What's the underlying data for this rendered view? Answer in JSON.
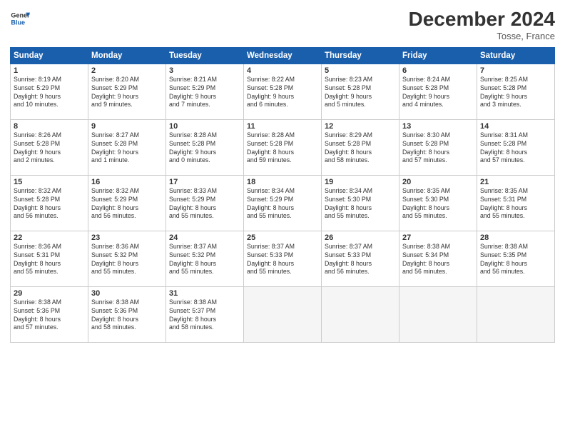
{
  "header": {
    "logo_line1": "General",
    "logo_line2": "Blue",
    "month_title": "December 2024",
    "location": "Tosse, France"
  },
  "weekdays": [
    "Sunday",
    "Monday",
    "Tuesday",
    "Wednesday",
    "Thursday",
    "Friday",
    "Saturday"
  ],
  "weeks": [
    [
      {
        "day": "1",
        "lines": [
          "Sunrise: 8:19 AM",
          "Sunset: 5:29 PM",
          "Daylight: 9 hours",
          "and 10 minutes."
        ]
      },
      {
        "day": "2",
        "lines": [
          "Sunrise: 8:20 AM",
          "Sunset: 5:29 PM",
          "Daylight: 9 hours",
          "and 9 minutes."
        ]
      },
      {
        "day": "3",
        "lines": [
          "Sunrise: 8:21 AM",
          "Sunset: 5:29 PM",
          "Daylight: 9 hours",
          "and 7 minutes."
        ]
      },
      {
        "day": "4",
        "lines": [
          "Sunrise: 8:22 AM",
          "Sunset: 5:28 PM",
          "Daylight: 9 hours",
          "and 6 minutes."
        ]
      },
      {
        "day": "5",
        "lines": [
          "Sunrise: 8:23 AM",
          "Sunset: 5:28 PM",
          "Daylight: 9 hours",
          "and 5 minutes."
        ]
      },
      {
        "day": "6",
        "lines": [
          "Sunrise: 8:24 AM",
          "Sunset: 5:28 PM",
          "Daylight: 9 hours",
          "and 4 minutes."
        ]
      },
      {
        "day": "7",
        "lines": [
          "Sunrise: 8:25 AM",
          "Sunset: 5:28 PM",
          "Daylight: 9 hours",
          "and 3 minutes."
        ]
      }
    ],
    [
      {
        "day": "8",
        "lines": [
          "Sunrise: 8:26 AM",
          "Sunset: 5:28 PM",
          "Daylight: 9 hours",
          "and 2 minutes."
        ]
      },
      {
        "day": "9",
        "lines": [
          "Sunrise: 8:27 AM",
          "Sunset: 5:28 PM",
          "Daylight: 9 hours",
          "and 1 minute."
        ]
      },
      {
        "day": "10",
        "lines": [
          "Sunrise: 8:28 AM",
          "Sunset: 5:28 PM",
          "Daylight: 9 hours",
          "and 0 minutes."
        ]
      },
      {
        "day": "11",
        "lines": [
          "Sunrise: 8:28 AM",
          "Sunset: 5:28 PM",
          "Daylight: 8 hours",
          "and 59 minutes."
        ]
      },
      {
        "day": "12",
        "lines": [
          "Sunrise: 8:29 AM",
          "Sunset: 5:28 PM",
          "Daylight: 8 hours",
          "and 58 minutes."
        ]
      },
      {
        "day": "13",
        "lines": [
          "Sunrise: 8:30 AM",
          "Sunset: 5:28 PM",
          "Daylight: 8 hours",
          "and 57 minutes."
        ]
      },
      {
        "day": "14",
        "lines": [
          "Sunrise: 8:31 AM",
          "Sunset: 5:28 PM",
          "Daylight: 8 hours",
          "and 57 minutes."
        ]
      }
    ],
    [
      {
        "day": "15",
        "lines": [
          "Sunrise: 8:32 AM",
          "Sunset: 5:28 PM",
          "Daylight: 8 hours",
          "and 56 minutes."
        ]
      },
      {
        "day": "16",
        "lines": [
          "Sunrise: 8:32 AM",
          "Sunset: 5:29 PM",
          "Daylight: 8 hours",
          "and 56 minutes."
        ]
      },
      {
        "day": "17",
        "lines": [
          "Sunrise: 8:33 AM",
          "Sunset: 5:29 PM",
          "Daylight: 8 hours",
          "and 55 minutes."
        ]
      },
      {
        "day": "18",
        "lines": [
          "Sunrise: 8:34 AM",
          "Sunset: 5:29 PM",
          "Daylight: 8 hours",
          "and 55 minutes."
        ]
      },
      {
        "day": "19",
        "lines": [
          "Sunrise: 8:34 AM",
          "Sunset: 5:30 PM",
          "Daylight: 8 hours",
          "and 55 minutes."
        ]
      },
      {
        "day": "20",
        "lines": [
          "Sunrise: 8:35 AM",
          "Sunset: 5:30 PM",
          "Daylight: 8 hours",
          "and 55 minutes."
        ]
      },
      {
        "day": "21",
        "lines": [
          "Sunrise: 8:35 AM",
          "Sunset: 5:31 PM",
          "Daylight: 8 hours",
          "and 55 minutes."
        ]
      }
    ],
    [
      {
        "day": "22",
        "lines": [
          "Sunrise: 8:36 AM",
          "Sunset: 5:31 PM",
          "Daylight: 8 hours",
          "and 55 minutes."
        ]
      },
      {
        "day": "23",
        "lines": [
          "Sunrise: 8:36 AM",
          "Sunset: 5:32 PM",
          "Daylight: 8 hours",
          "and 55 minutes."
        ]
      },
      {
        "day": "24",
        "lines": [
          "Sunrise: 8:37 AM",
          "Sunset: 5:32 PM",
          "Daylight: 8 hours",
          "and 55 minutes."
        ]
      },
      {
        "day": "25",
        "lines": [
          "Sunrise: 8:37 AM",
          "Sunset: 5:33 PM",
          "Daylight: 8 hours",
          "and 55 minutes."
        ]
      },
      {
        "day": "26",
        "lines": [
          "Sunrise: 8:37 AM",
          "Sunset: 5:33 PM",
          "Daylight: 8 hours",
          "and 56 minutes."
        ]
      },
      {
        "day": "27",
        "lines": [
          "Sunrise: 8:38 AM",
          "Sunset: 5:34 PM",
          "Daylight: 8 hours",
          "and 56 minutes."
        ]
      },
      {
        "day": "28",
        "lines": [
          "Sunrise: 8:38 AM",
          "Sunset: 5:35 PM",
          "Daylight: 8 hours",
          "and 56 minutes."
        ]
      }
    ],
    [
      {
        "day": "29",
        "lines": [
          "Sunrise: 8:38 AM",
          "Sunset: 5:36 PM",
          "Daylight: 8 hours",
          "and 57 minutes."
        ]
      },
      {
        "day": "30",
        "lines": [
          "Sunrise: 8:38 AM",
          "Sunset: 5:36 PM",
          "Daylight: 8 hours",
          "and 58 minutes."
        ]
      },
      {
        "day": "31",
        "lines": [
          "Sunrise: 8:38 AM",
          "Sunset: 5:37 PM",
          "Daylight: 8 hours",
          "and 58 minutes."
        ]
      },
      {
        "day": "",
        "lines": []
      },
      {
        "day": "",
        "lines": []
      },
      {
        "day": "",
        "lines": []
      },
      {
        "day": "",
        "lines": []
      }
    ]
  ]
}
